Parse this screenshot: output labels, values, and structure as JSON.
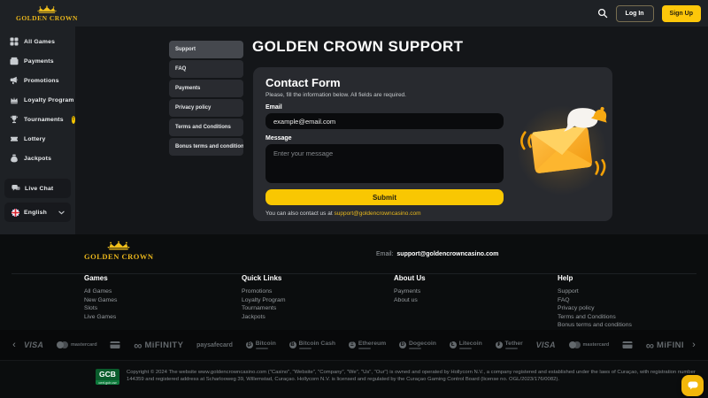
{
  "topbar": {
    "brand": "GOLDEN CROWN",
    "login_label": "Log In",
    "signup_label": "Sign Up"
  },
  "sidebar": {
    "items": [
      {
        "label": "All Games"
      },
      {
        "label": "Payments"
      },
      {
        "label": "Promotions"
      },
      {
        "label": "Loyalty Program"
      },
      {
        "label": "Tournaments",
        "badge": "!"
      },
      {
        "label": "Lottery"
      },
      {
        "label": "Jackpots"
      }
    ],
    "live_chat": "Live Chat",
    "language": "English"
  },
  "support_menu": [
    "Support",
    "FAQ",
    "Payments",
    "Privacy policy",
    "Terms and Conditions",
    "Bonus terms and conditions"
  ],
  "main": {
    "title": "GOLDEN CROWN SUPPORT",
    "form": {
      "title": "Contact Form",
      "subtitle": "Please, fill the information below. All fields are required.",
      "email_label": "Email",
      "email_placeholder": "example@email.com",
      "message_label": "Message",
      "message_placeholder": "Enter your message",
      "submit": "Submit",
      "note": "You can also contact us at",
      "note_link": "support@goldencrowncasino.com"
    }
  },
  "footer": {
    "brand": "GOLDEN CROWN",
    "email_label": "Email:",
    "email_value": "support@goldencrowncasino.com",
    "columns": [
      {
        "title": "Games",
        "links": [
          "All Games",
          "New Games",
          "Slots",
          "Live Games"
        ]
      },
      {
        "title": "Quick Links",
        "links": [
          "Promotions",
          "Loyalty Program",
          "Tournaments",
          "Jackpots"
        ]
      },
      {
        "title": "About Us",
        "links": [
          "Payments",
          "About us"
        ]
      },
      {
        "title": "Help",
        "links": [
          "Support",
          "FAQ",
          "Privacy policy",
          "Terms and Conditions",
          "Bonus terms and conditions"
        ]
      }
    ],
    "carousel": {
      "prev": "‹",
      "next": "›"
    },
    "payments": [
      {
        "name": "VISA"
      },
      {
        "name": "mastercard"
      },
      {
        "name": ""
      },
      {
        "name": "MiFINITY"
      },
      {
        "name": "paysafecard"
      },
      {
        "name": "Bitcoin",
        "symbol": "₿"
      },
      {
        "name": "Bitcoin Cash",
        "symbol": "Ƀ"
      },
      {
        "name": "Ethereum",
        "symbol": "Ξ"
      },
      {
        "name": "Dogecoin",
        "symbol": "Ð"
      },
      {
        "name": "Litecoin",
        "symbol": "Ł"
      },
      {
        "name": "Tether",
        "symbol": "₮"
      },
      {
        "name": "VISA"
      },
      {
        "name": "mastercard"
      },
      {
        "name": ""
      },
      {
        "name": "MiFINI"
      }
    ],
    "gcb": {
      "text": "GCB",
      "sub": "cert.gcb.cw"
    },
    "copyright": "Copyright © 2024 The website www.goldencrowncasino.com (\"Casino\", \"Website\", \"Company\", \"We\", \"Us\", \"Our\") is owned and operated by Hollycorn N.V., a company registered and established under the laws of Curaçao, with registration number 144359 and registered address at Scharlooweg 39, Willemstad, Curaçao. Hollycorn N.V. is licensed and regulated by the Curaçao Gaming Control Board (license no. OGL/2023/176/0082)."
  },
  "colors": {
    "gold": "#f9c702",
    "gold_text": "#e9b61c",
    "page_bg": "#141619",
    "panel_bg": "#1e2125",
    "card_bg": "#282a2f",
    "input_bg": "#0a0b0d",
    "footer_bg": "#0b0d0e"
  }
}
